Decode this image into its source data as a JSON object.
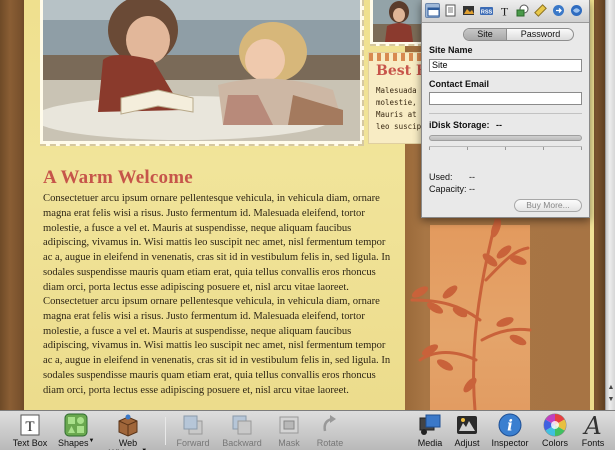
{
  "page": {
    "heading": "A Warm Welcome",
    "paragraphs": [
      "Consectetuer arcu ipsum ornare pellentesque vehicula, in vehicula diam, ornare magna erat felis wisi a risus. Justo fermentum id. Malesuada eleifend, tortor molestie, a fusce a vel et. Mauris at suspendisse, neque aliquam faucibus adipiscing, vivamus in. Wisi mattis leo suscipit nec amet, nisl fermentum tempor ac a, augue in eleifend in venenatis, cras sit id in vestibulum felis in, sed ligula. In sodales suspendisse mauris quam etiam erat, quia tellus convallis eros rhoncus diam orci, porta lectus esse adipiscing posuere et, nisl arcu vitae laoreet.",
      "Consectetuer arcu ipsum ornare pellentesque vehicula, in vehicula diam, ornare magna erat felis wisi a risus. Justo fermentum id. Malesuada eleifend, tortor molestie, a fusce a vel et. Mauris at suspendisse, neque aliquam faucibus adipiscing, vivamus in. Wisi mattis leo suscipit nec amet, nisl fermentum tempor ac a, augue in eleifend in venenatis, cras sit id in vestibulum felis in, sed ligula. In sodales suspendisse mauris quam etiam erat, quia tellus convallis eros rhoncus diam orci, porta lectus esse adipiscing posuere et, nisl arcu vitae laoreet."
    ],
    "side_title": "Best F",
    "side_lines": [
      "Malesuada e",
      "molestie, a",
      "Mauris at s",
      "leo suscip"
    ]
  },
  "inspector": {
    "toolbar_icons": [
      "page-inspector-icon",
      "document-inspector-icon",
      "photo-inspector-icon",
      "rss-inspector-icon",
      "text-inspector-icon",
      "graphic-inspector-icon",
      "metrics-inspector-icon",
      "link-inspector-icon",
      "publish-inspector-icon"
    ],
    "rss_label": "RSS",
    "text_label": "T",
    "tab_site": "Site",
    "tab_password": "Password",
    "site_name_label": "Site Name",
    "site_name_value": "Site",
    "contact_email_label": "Contact Email",
    "contact_email_value": "",
    "idisk_label": "iDisk Storage:",
    "idisk_value": "--",
    "storage_used_fraction": 0,
    "used_label": "Used:",
    "used_value": "--",
    "capacity_label": "Capacity:",
    "capacity_value": "--",
    "buy_more_label": "Buy More..."
  },
  "toolbar": {
    "text_box": "Text Box",
    "shapes": "Shapes",
    "web_widgets": "Web Widgets",
    "forward": "Forward",
    "backward": "Backward",
    "mask": "Mask",
    "rotate": "Rotate",
    "media": "Media",
    "adjust": "Adjust",
    "inspector": "Inspector",
    "colors": "Colors",
    "fonts": "Fonts"
  },
  "colors": {
    "heading": "#c6554a",
    "paper": "#f1e49a",
    "brown_band": "#a77444",
    "orange_panel": "#e4a46a",
    "inspector_active": "#9fb8d8"
  }
}
